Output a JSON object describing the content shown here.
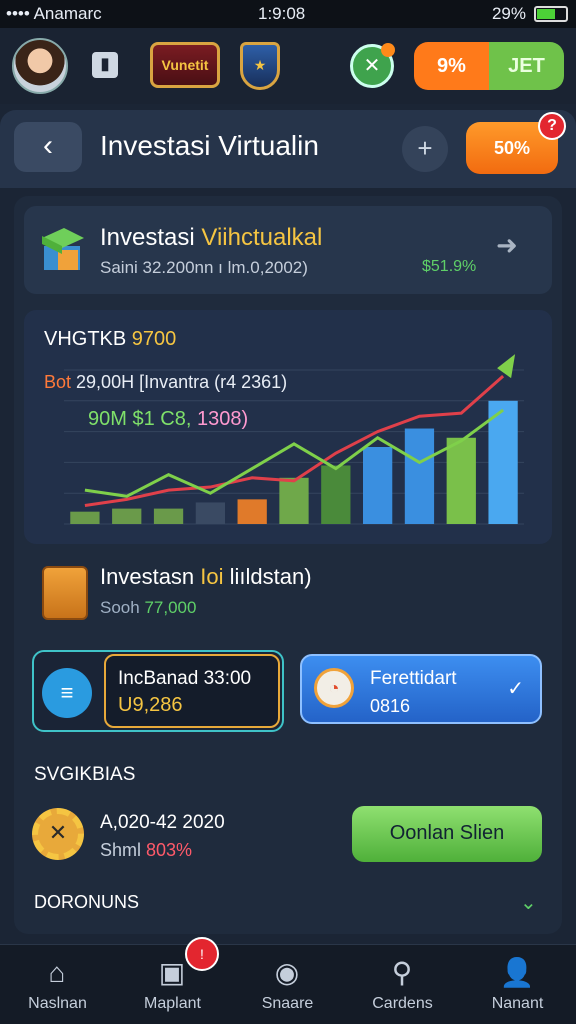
{
  "status": {
    "carrier": "•••• Anamarc",
    "time": "1:9:08",
    "battery": "29%"
  },
  "header": {
    "badge_text": "Vunetit",
    "pill_left": "9%",
    "pill_right": "JET"
  },
  "page": {
    "title": "Investasi Virtualin",
    "notif_label": "50%",
    "notif_count": "?"
  },
  "card": {
    "title_main": "Investasi ",
    "title_accent": "Viihctualkal",
    "subtitle": "Saini 32.200nn ı lm.0,2002)",
    "value": "$51.9%"
  },
  "chart_panel": {
    "line1_main": "VHGTKB ",
    "line1_accent": "9700",
    "line2_accent": "Bot ",
    "line2_main": "29,00H [Invantra (r4 2361)",
    "line3_main": "90M $1 C8, ",
    "line3_accent": "1308)"
  },
  "chart_data": {
    "type": "bar",
    "values": [
      0.08,
      0.1,
      0.1,
      0.14,
      0.16,
      0.3,
      0.38,
      0.5,
      0.62,
      0.56,
      0.8
    ],
    "line": [
      0.22,
      0.18,
      0.32,
      0.2,
      0.36,
      0.52,
      0.36,
      0.56,
      0.4,
      0.54,
      0.74
    ],
    "line2": [
      0.12,
      0.16,
      0.22,
      0.24,
      0.3,
      0.28,
      0.46,
      0.6,
      0.7,
      0.72,
      0.96
    ]
  },
  "invest": {
    "title_main": "Investasn ",
    "title_accent": "Ioi ",
    "title_tail": "liıldstan)",
    "sub_main": "Sooh ",
    "sub_accent": "77,000"
  },
  "box_left": {
    "label": "IncBanad 33:00",
    "value": "U9,286"
  },
  "box_right": {
    "label": "Ferettidart",
    "value": "0816"
  },
  "section": {
    "heading": "SVGIKBIAS",
    "date": "A,020-42 2020",
    "share_main": "Shml ",
    "share_accent": "803%",
    "button": "Oonlan Slien",
    "footer": "DORONUNS"
  },
  "nav": [
    {
      "label": "Naslnan",
      "icon": "home-icon"
    },
    {
      "label": "Maplant",
      "icon": "map-icon",
      "badge": "!"
    },
    {
      "label": "Snaare",
      "icon": "share-icon"
    },
    {
      "label": "Cardens",
      "icon": "cards-icon"
    },
    {
      "label": "Nanant",
      "icon": "profile-icon"
    }
  ],
  "colors": {
    "accent_gold": "#f5c542",
    "accent_green": "#5fd068",
    "accent_orange": "#f26b10",
    "accent_blue": "#2463c8"
  }
}
